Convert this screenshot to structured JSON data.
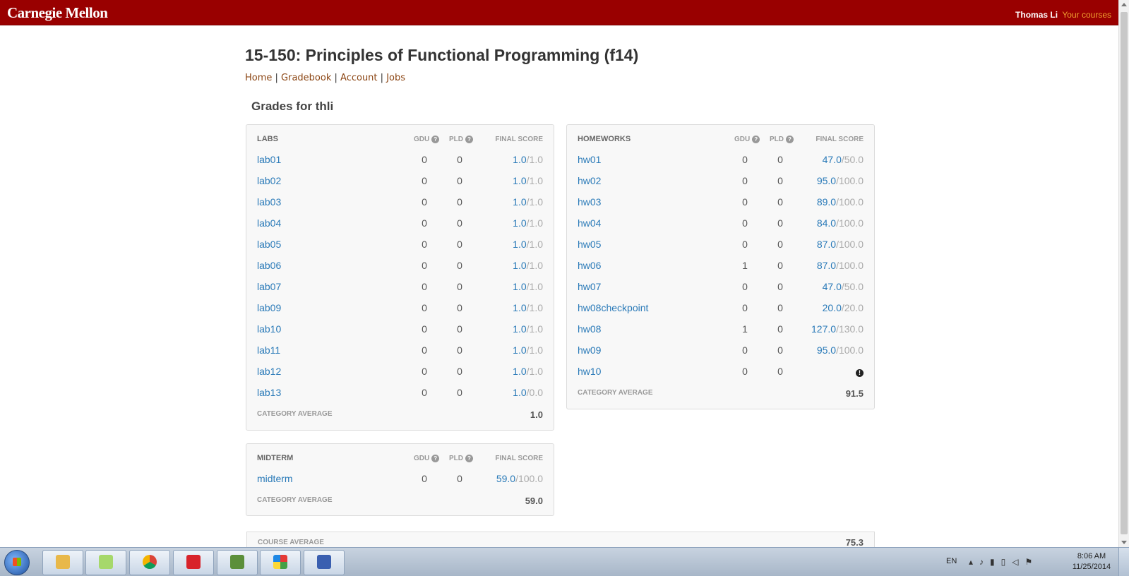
{
  "header": {
    "logo_text": "Carnegie Mellon",
    "user_name": "Thomas Li",
    "courses_link": "Your courses"
  },
  "course": {
    "title": "15-150: Principles of Functional Programming (f14)",
    "nav": [
      "Home",
      "Gradebook",
      "Account",
      "Jobs"
    ],
    "grades_heading": "Grades for thli"
  },
  "columns": {
    "gdu": "GDU",
    "pld": "PLD",
    "final": "FINAL SCORE",
    "help_icon": "?"
  },
  "labs": {
    "title": "LABS",
    "rows": [
      {
        "name": "lab01",
        "gdu": "0",
        "pld": "0",
        "earned": "1.0",
        "possible": "1.0"
      },
      {
        "name": "lab02",
        "gdu": "0",
        "pld": "0",
        "earned": "1.0",
        "possible": "1.0"
      },
      {
        "name": "lab03",
        "gdu": "0",
        "pld": "0",
        "earned": "1.0",
        "possible": "1.0"
      },
      {
        "name": "lab04",
        "gdu": "0",
        "pld": "0",
        "earned": "1.0",
        "possible": "1.0"
      },
      {
        "name": "lab05",
        "gdu": "0",
        "pld": "0",
        "earned": "1.0",
        "possible": "1.0"
      },
      {
        "name": "lab06",
        "gdu": "0",
        "pld": "0",
        "earned": "1.0",
        "possible": "1.0"
      },
      {
        "name": "lab07",
        "gdu": "0",
        "pld": "0",
        "earned": "1.0",
        "possible": "1.0"
      },
      {
        "name": "lab09",
        "gdu": "0",
        "pld": "0",
        "earned": "1.0",
        "possible": "1.0"
      },
      {
        "name": "lab10",
        "gdu": "0",
        "pld": "0",
        "earned": "1.0",
        "possible": "1.0"
      },
      {
        "name": "lab11",
        "gdu": "0",
        "pld": "0",
        "earned": "1.0",
        "possible": "1.0"
      },
      {
        "name": "lab12",
        "gdu": "0",
        "pld": "0",
        "earned": "1.0",
        "possible": "1.0"
      },
      {
        "name": "lab13",
        "gdu": "0",
        "pld": "0",
        "earned": "1.0",
        "possible": "0.0"
      }
    ],
    "avg_label": "CATEGORY AVERAGE",
    "avg_value": "1.0"
  },
  "homeworks": {
    "title": "HOMEWORKS",
    "rows": [
      {
        "name": "hw01",
        "gdu": "0",
        "pld": "0",
        "earned": "47.0",
        "possible": "50.0"
      },
      {
        "name": "hw02",
        "gdu": "0",
        "pld": "0",
        "earned": "95.0",
        "possible": "100.0"
      },
      {
        "name": "hw03",
        "gdu": "0",
        "pld": "0",
        "earned": "89.0",
        "possible": "100.0"
      },
      {
        "name": "hw04",
        "gdu": "0",
        "pld": "0",
        "earned": "84.0",
        "possible": "100.0"
      },
      {
        "name": "hw05",
        "gdu": "0",
        "pld": "0",
        "earned": "87.0",
        "possible": "100.0"
      },
      {
        "name": "hw06",
        "gdu": "1",
        "pld": "0",
        "earned": "87.0",
        "possible": "100.0"
      },
      {
        "name": "hw07",
        "gdu": "0",
        "pld": "0",
        "earned": "47.0",
        "possible": "50.0"
      },
      {
        "name": "hw08checkpoint",
        "gdu": "0",
        "pld": "0",
        "earned": "20.0",
        "possible": "20.0"
      },
      {
        "name": "hw08",
        "gdu": "1",
        "pld": "0",
        "earned": "127.0",
        "possible": "130.0"
      },
      {
        "name": "hw09",
        "gdu": "0",
        "pld": "0",
        "earned": "95.0",
        "possible": "100.0"
      },
      {
        "name": "hw10",
        "gdu": "0",
        "pld": "0",
        "earned": "",
        "possible": "",
        "pending_icon": "!"
      }
    ],
    "avg_label": "CATEGORY AVERAGE",
    "avg_value": "91.5"
  },
  "midterm": {
    "title": "MIDTERM",
    "rows": [
      {
        "name": "midterm",
        "gdu": "0",
        "pld": "0",
        "earned": "59.0",
        "possible": "100.0"
      }
    ],
    "avg_label": "CATEGORY AVERAGE",
    "avg_value": "59.0"
  },
  "course_average": {
    "label": "COURSE AVERAGE",
    "value": "75.3"
  },
  "taskbar": {
    "apps": [
      "file-explorer-icon",
      "sticky-notes-icon",
      "chrome-icon",
      "adobe-reader-icon",
      "matlab-icon",
      "avg-antivirus-icon",
      "network-icon"
    ],
    "language": "EN",
    "time": "8:06 AM",
    "date": "11/25/2014"
  },
  "colors": {
    "brand": "#990000",
    "link": "#2a7ab8",
    "accent": "#f0a030"
  }
}
